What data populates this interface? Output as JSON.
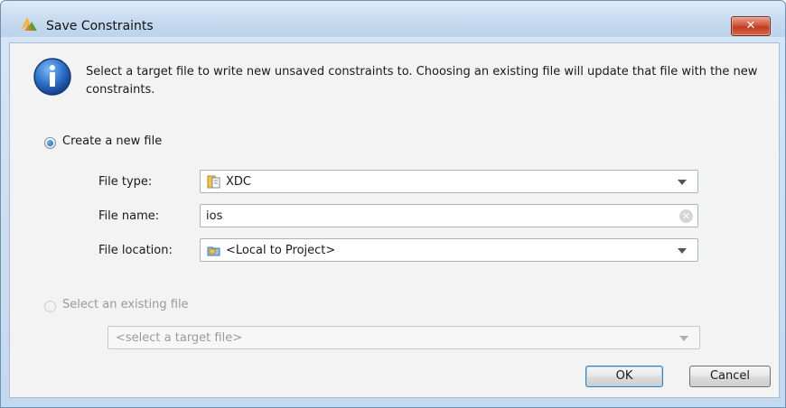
{
  "window": {
    "title": "Save Constraints",
    "close_label": "✕"
  },
  "info": {
    "message": "Select a target file to write new unsaved constraints to. Choosing an existing file will update that file with the new constraints."
  },
  "create_new": {
    "label": "Create a new file",
    "selected": true,
    "file_type_label": "File type:",
    "file_type_value": "XDC",
    "file_name_label": "File name:",
    "file_name_value": "ios",
    "file_location_label": "File location:",
    "file_location_value": "<Local to Project>"
  },
  "select_existing": {
    "label": "Select an existing file",
    "selected": false,
    "target_placeholder": "<select a target file>"
  },
  "buttons": {
    "ok": "OK",
    "cancel": "Cancel"
  },
  "colors": {
    "titlebar": "#c8dbf0",
    "close_button": "#c23b1f",
    "dialog_body": "#f3f3f3",
    "default_button_border": "#3c7fb1"
  }
}
